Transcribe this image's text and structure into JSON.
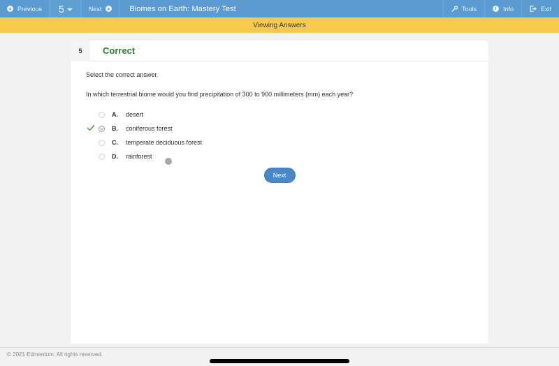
{
  "topbar": {
    "previous_label": "Previous",
    "question_number": "5",
    "next_label": "Next",
    "test_title": "Biomes on Earth: Mastery Test",
    "tools_label": "Tools",
    "info_label": "Info",
    "exit_label": "Exit",
    "bar_color": "#5b9bd1"
  },
  "statusbar": {
    "text": "Viewing Answers",
    "background_color": "#f6ca4c"
  },
  "card": {
    "question_number": "5",
    "verdict": "Correct",
    "verdict_color": "#2f7d32",
    "instruction": "Select the correct answer.",
    "question": "In which terrestrial biome would you find precipitation of 300 to 900 millimeters (mm) each year?",
    "options": [
      {
        "letter": "A.",
        "text": "desert",
        "selected": false,
        "correct": false
      },
      {
        "letter": "B.",
        "text": "coniferous forest",
        "selected": true,
        "correct": true
      },
      {
        "letter": "C.",
        "text": "temperate deciduous forest",
        "selected": false,
        "correct": false
      },
      {
        "letter": "D.",
        "text": "rainforest",
        "selected": false,
        "correct": false
      }
    ],
    "next_button_label": "Next",
    "next_button_color": "#4a86c8"
  },
  "footer": {
    "copyright": "© 2021 Edmentum. All rights reserved."
  }
}
